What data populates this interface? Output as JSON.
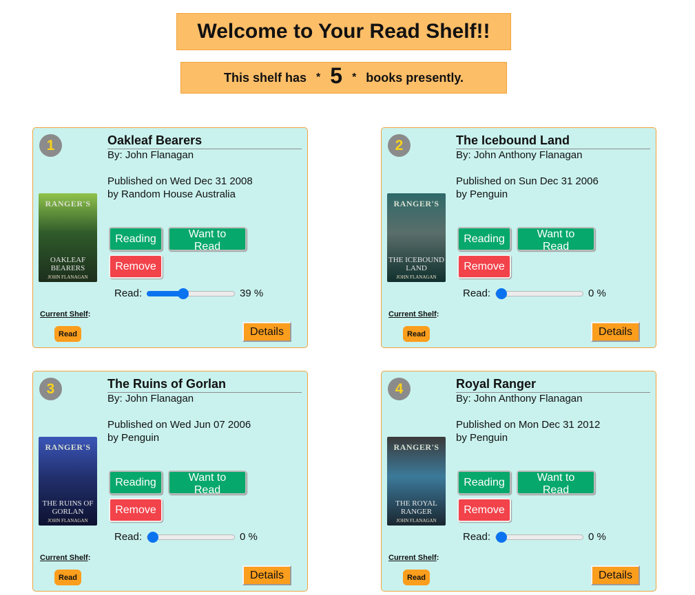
{
  "header": {
    "title": "Welcome to Your Read Shelf!!",
    "count_prefix": "This shelf has",
    "count_star": "*",
    "count_value": "5",
    "count_suffix": "books presently."
  },
  "colors": {
    "header_bg": "#fdbe68",
    "card_bg": "#c9f2ee",
    "card_border": "#f0a33d",
    "green_button": "#07a86c",
    "red_button": "#f2424a",
    "orange_accent": "#fb9d1d",
    "slider_blue": "#0b73f0"
  },
  "labels": {
    "reading": "Reading",
    "want_to_read": "Want to Read",
    "remove": "Remove",
    "read": "Read:",
    "current_shelf": "Current Shelf",
    "colon": ":",
    "details": "Details",
    "percent_sign": "%"
  },
  "books": [
    {
      "index": "1",
      "title": "Oakleaf Bearers",
      "author": "By: John Flanagan",
      "published": "Published on Wed Dec 31 2008",
      "publisher": "by Random House Australia",
      "progress_percent": 39,
      "progress_label": "39 %",
      "shelf": "Read",
      "cover": {
        "top": "RANGER'S",
        "title": "OAKLEAF BEARERS",
        "author": "JOHN FLANAGAN",
        "colors": [
          "#8fc24a",
          "#2f5a2a",
          "#1c2e1c"
        ]
      }
    },
    {
      "index": "2",
      "title": "The Icebound Land",
      "author": "By: John Anthony Flanagan",
      "published": "Published on Sun Dec 31 2006",
      "publisher": "by Penguin",
      "progress_percent": 0,
      "progress_label": "0 %",
      "shelf": "Read",
      "cover": {
        "top": "RANGER'S",
        "title": "THE ICEBOUND LAND",
        "author": "JOHN FLANAGAN",
        "colors": [
          "#2f6a6a",
          "#5a6e6a",
          "#10302e"
        ]
      }
    },
    {
      "index": "3",
      "title": "The Ruins of Gorlan",
      "author": "By: John Flanagan",
      "published": "Published on Wed Jun 07 2006",
      "publisher": "by Penguin",
      "progress_percent": 0,
      "progress_label": "0 %",
      "shelf": "Read",
      "cover": {
        "top": "RANGER'S",
        "title": "THE RUINS OF GORLAN",
        "author": "JOHN FLANAGAN",
        "colors": [
          "#3b56b8",
          "#22306e",
          "#0d1230"
        ]
      }
    },
    {
      "index": "4",
      "title": "Royal Ranger",
      "author": "By: John Anthony Flanagan",
      "published": "Published on Mon Dec 31 2012",
      "publisher": "by Penguin",
      "progress_percent": 0,
      "progress_label": "0 %",
      "shelf": "Read",
      "cover": {
        "top": "RANGER'S",
        "title": "THE ROYAL RANGER",
        "author": "JOHN FLANAGAN",
        "colors": [
          "#3a3a3a",
          "#3c7a9a",
          "#1a2630"
        ]
      }
    }
  ]
}
